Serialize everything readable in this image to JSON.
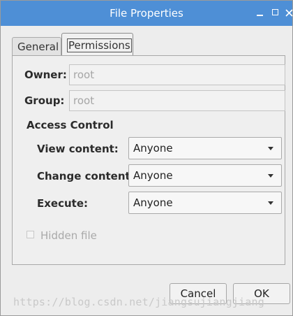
{
  "window": {
    "title": "File Properties"
  },
  "titlebar": {
    "close_glyph": "×",
    "icons": [
      "minimize-icon",
      "maximize-icon",
      "close-icon"
    ]
  },
  "tabs": [
    {
      "label": "General",
      "active": false
    },
    {
      "label": "Permissions",
      "active": true
    }
  ],
  "permissions": {
    "owner_label": "Owner:",
    "owner_value": "root",
    "group_label": "Group:",
    "group_value": "root",
    "access_control_heading": "Access Control",
    "view_content_label": "View content:",
    "view_content_value": "Anyone",
    "change_content_label": "Change content:",
    "change_content_value": "Anyone",
    "execute_label": "Execute:",
    "execute_value": "Anyone",
    "hidden_file_label": "Hidden file",
    "hidden_file_checked": false
  },
  "buttons": {
    "cancel_label": "Cancel",
    "ok_label": "OK"
  },
  "watermark": "https://blog.csdn.net/jiangsujiangjiang",
  "colors": {
    "titlebar": "#4e8fd6",
    "window_bg": "#ededed"
  }
}
